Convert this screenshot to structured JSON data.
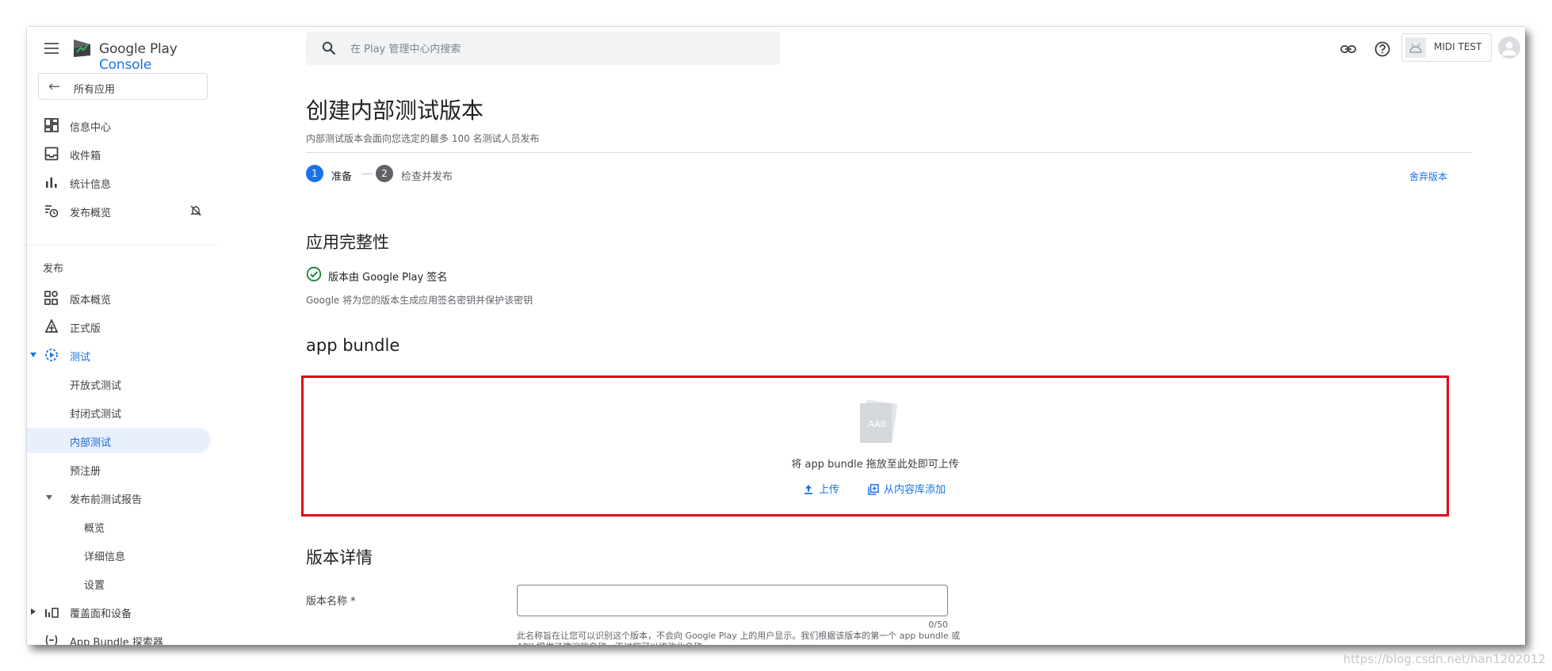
{
  "brand": {
    "name": "Google Play",
    "product": "Console"
  },
  "sidebar": {
    "back_label": "所有应用",
    "top_items": [
      {
        "label": "信息中心",
        "icon": "dashboard-icon"
      },
      {
        "label": "收件箱",
        "icon": "inbox-icon"
      },
      {
        "label": "统计信息",
        "icon": "bar-chart-icon"
      },
      {
        "label": "发布概览",
        "icon": "publishing-overview-icon"
      }
    ],
    "section_release": "发布",
    "release_items": [
      {
        "label": "版本概览",
        "icon": "release-overview-icon"
      },
      {
        "label": "正式版",
        "icon": "production-icon"
      },
      {
        "label": "测试",
        "icon": "testing-icon"
      }
    ],
    "testing_items": [
      {
        "label": "开放式测试"
      },
      {
        "label": "封闭式测试"
      },
      {
        "label": "内部测试"
      },
      {
        "label": "预注册"
      }
    ],
    "prelaunch": {
      "label": "发布前测试报告",
      "items": [
        {
          "label": "概览"
        },
        {
          "label": "详细信息"
        },
        {
          "label": "设置"
        }
      ]
    },
    "reach_label": "覆盖面和设备",
    "bundle_explorer_label": "App Bundle 探索器"
  },
  "search": {
    "placeholder": "在 Play 管理中心内搜索"
  },
  "topbar": {
    "app_name": "MIDI TEST"
  },
  "page": {
    "title": "创建内部测试版本",
    "subtitle": "内部测试版本会面向您选定的最多 100 名测试人员发布",
    "steps": [
      {
        "num": "1",
        "label": "准备"
      },
      {
        "num": "2",
        "label": "检查并发布"
      }
    ],
    "discard_label": "舍弃版本"
  },
  "integrity": {
    "heading": "应用完整性",
    "signed_label": "版本由 Google Play 签名",
    "description": "Google 将为您的版本生成应用签名密钥并保护该密钥"
  },
  "bundle": {
    "heading": "app bundle",
    "file_badge": ".AAB",
    "drop_text": "将 app bundle 拖放至此处即可上传",
    "upload_label": "上传",
    "library_label": "从内容库添加"
  },
  "details": {
    "heading": "版本详情",
    "name_label": "版本名称 *",
    "name_value": "",
    "counter": "0/50",
    "help_text": "此名称旨在让您可以识别这个版本，不会向 Google Play 上的用户显示。我们根据该版本的第一个 app bundle 或 APK 提供了建议的名称，不过您可以修改此名称。"
  },
  "watermark": "https://blog.csdn.net/han1202012",
  "colors": {
    "accent": "#1a73e8",
    "highlight_border": "#e0001b",
    "success": "#188038"
  }
}
